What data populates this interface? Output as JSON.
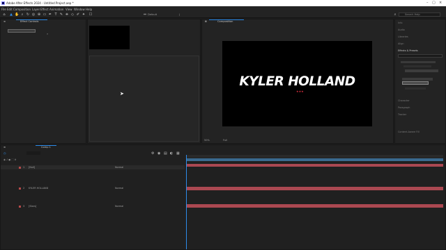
{
  "window": {
    "title": "Adobe After Effects 2024 - Untitled Project.aep *"
  },
  "menu": [
    "File",
    "Edit",
    "Composition",
    "Layer",
    "Effect",
    "Animation",
    "View",
    "Window",
    "Help"
  ],
  "toolbar": {
    "workspace_label": "Default",
    "search_placeholder": "Search Help"
  },
  "project_panel": {
    "tab_label": "Effect Controls"
  },
  "composition_panel": {
    "tab_label": "Composition",
    "headline": "KYLER HOLLAND",
    "stars": "★★★",
    "zoom": "50%",
    "resolution": "Full"
  },
  "right_panel": {
    "items": [
      "Info",
      "Audio",
      "Libraries",
      "Align",
      "Effects & Presets",
      "Character",
      "Paragraph",
      "Tracker",
      "Content-Aware Fill"
    ]
  },
  "timeline": {
    "tab_label": "Comp 1",
    "layers": [
      {
        "num": "1",
        "name": "[Null]",
        "mode": "Normal"
      },
      {
        "num": "2",
        "name": "KYLER HOLLAND",
        "mode": "Normal"
      },
      {
        "num": "3",
        "name": "[Stars]",
        "mode": "Normal"
      }
    ]
  },
  "colors": {
    "accent": "#2d8ceb",
    "layer_bar": "#c4505a",
    "panel_bg": "#232323"
  }
}
